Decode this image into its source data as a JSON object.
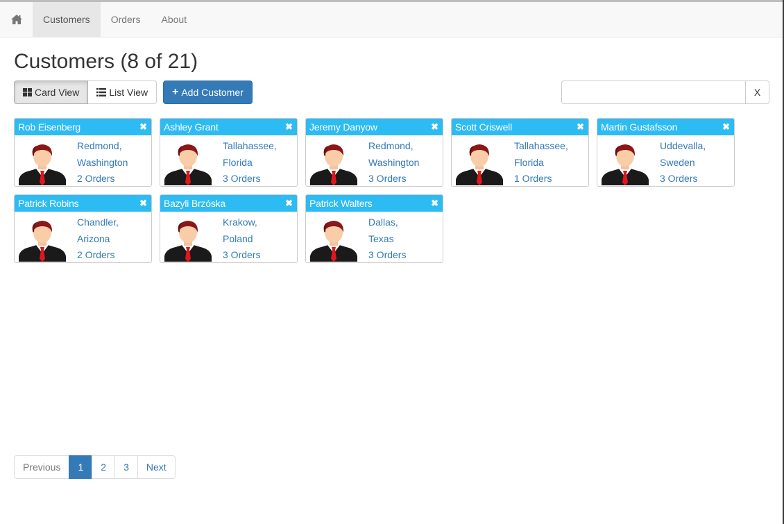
{
  "nav": {
    "home_icon": "home-icon",
    "items": [
      {
        "label": "Customers",
        "active": true
      },
      {
        "label": "Orders",
        "active": false
      },
      {
        "label": "About",
        "active": false
      }
    ]
  },
  "page": {
    "title": "Customers (8 of 21)"
  },
  "toolbar": {
    "card_view_label": "Card View",
    "card_view_icon": "grid-icon",
    "list_view_label": "List View",
    "list_view_icon": "list-icon",
    "add_label": "Add Customer",
    "add_icon": "plus-icon"
  },
  "search": {
    "value": "",
    "placeholder": "",
    "clear_label": "X"
  },
  "colors": {
    "card_header": "#2dbbf3",
    "primary": "#337ab7",
    "link": "#337ab7"
  },
  "customers": [
    {
      "name": "Rob Eisenberg",
      "city": "Redmond,",
      "state": "Washington",
      "orders": "2 Orders"
    },
    {
      "name": "Ashley Grant",
      "city": "Tallahassee,",
      "state": "Florida",
      "orders": "3 Orders"
    },
    {
      "name": "Jeremy Danyow",
      "city": "Redmond,",
      "state": "Washington",
      "orders": "3 Orders"
    },
    {
      "name": "Scott Criswell",
      "city": "Tallahassee,",
      "state": "Florida",
      "orders": "1 Orders"
    },
    {
      "name": "Martin Gustafsson",
      "city": "Uddevalla,",
      "state": "Sweden",
      "orders": "3 Orders"
    },
    {
      "name": "Patrick Robins",
      "city": "Chandler,",
      "state": "Arizona",
      "orders": "2 Orders"
    },
    {
      "name": "Bazyli Brzóska",
      "city": "Krakow,",
      "state": "Poland",
      "orders": "3 Orders"
    },
    {
      "name": "Patrick Walters",
      "city": "Dallas,",
      "state": "Texas",
      "orders": "3 Orders"
    }
  ],
  "pagination": {
    "previous": "Previous",
    "pages": [
      "1",
      "2",
      "3"
    ],
    "active_page": "1",
    "next": "Next"
  }
}
